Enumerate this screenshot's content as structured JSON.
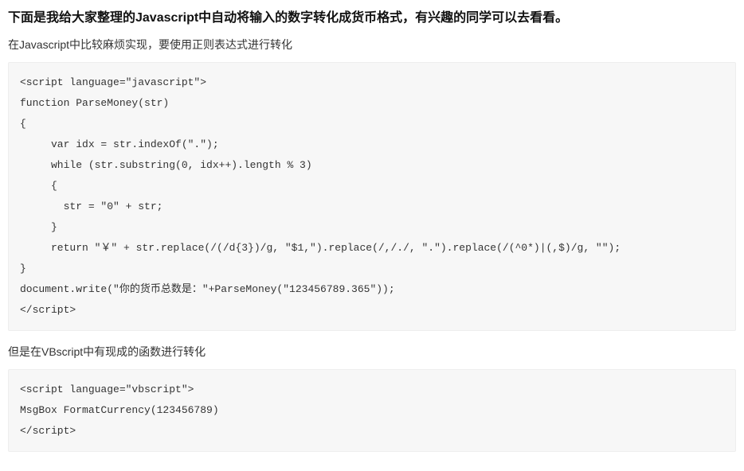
{
  "title": "下面是我给大家整理的Javascript中自动将输入的数字转化成货币格式，有兴趣的同学可以去看看。",
  "intro": "在Javascript中比较麻烦实现，要使用正则表达式进行转化",
  "code1": "<script language=\"javascript\">\nfunction ParseMoney(str)\n{\n     var idx = str.indexOf(\".\");\n     while (str.substring(0, idx++).length % 3)\n     {\n       str = \"0\" + str;\n     }\n     return \"￥\" + str.replace(/(/d{3})/g, \"$1,\").replace(/,/./, \".\").replace(/(^0*)|(,$)/g, \"\");\n}\ndocument.write(\"你的货币总数是：\"+ParseMoney(\"123456789.365\"));\n</script>",
  "mid": "但是在VBscript中有现成的函数进行转化",
  "code2": "<script language=\"vbscript\">\nMsgBox FormatCurrency(123456789)\n</script>"
}
